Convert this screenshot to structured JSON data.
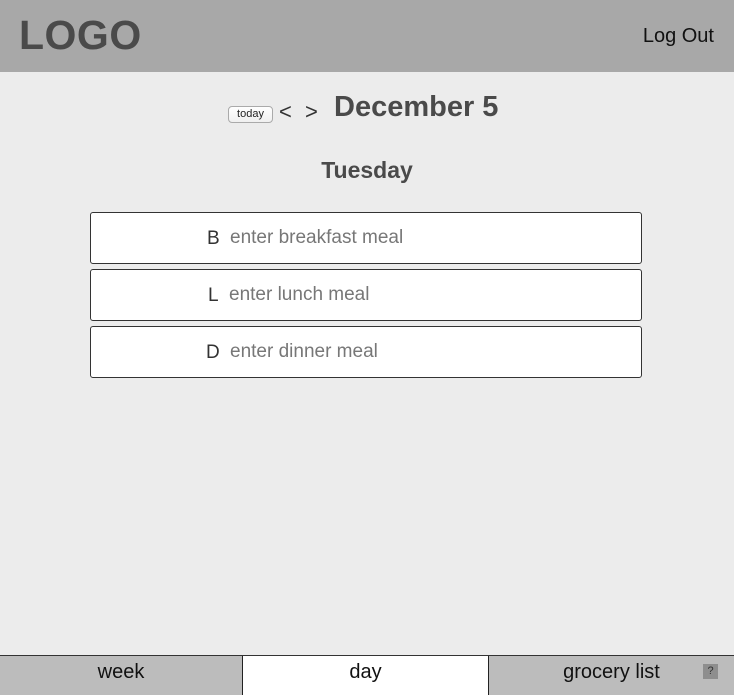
{
  "header": {
    "logo": "LOGO",
    "logout_label": "Log Out"
  },
  "date_nav": {
    "today_label": "today",
    "prev_symbol": "<",
    "next_symbol": ">",
    "date_title": "December 5",
    "weekday": "Tuesday"
  },
  "meals": [
    {
      "letter": "B",
      "placeholder": "enter breakfast meal",
      "value": ""
    },
    {
      "letter": "L",
      "placeholder": "enter lunch meal",
      "value": ""
    },
    {
      "letter": "D",
      "placeholder": "enter dinner meal",
      "value": ""
    }
  ],
  "tabs": [
    {
      "label": "week",
      "active": false
    },
    {
      "label": "day",
      "active": true
    },
    {
      "label": "grocery list",
      "active": false
    }
  ],
  "help_icon": {
    "symbol": "?",
    "icon": "help-icon"
  },
  "colors": {
    "header_bg": "#a8a8a8",
    "page_bg": "#ececec",
    "tab_bg": "#bcbcbc",
    "active_tab_bg": "#ffffff",
    "text": "#4a4a4a"
  }
}
